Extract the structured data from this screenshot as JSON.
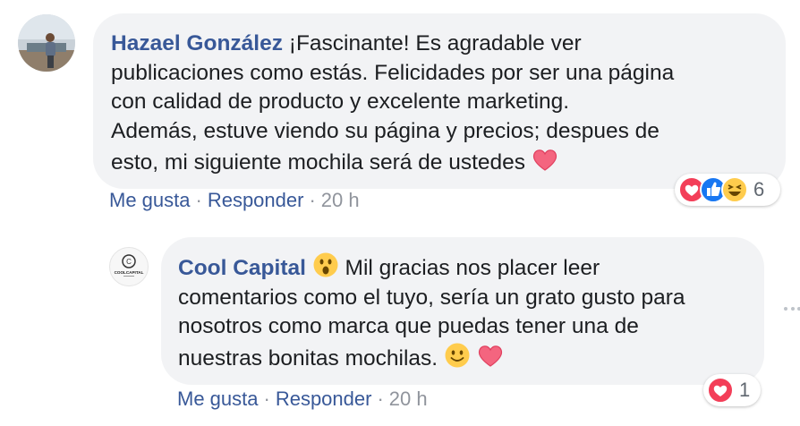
{
  "comment": {
    "author": "Hazael González",
    "text_lines": [
      "¡Fascinante! Es agradable ver",
      "publicaciones como estás. Felicidades por ser una página",
      "con calidad de producto y excelente marketing.",
      "Además, estuve viendo su página y precios; despues de",
      "esto, mi siguiente mochila será de ustedes"
    ],
    "actions": {
      "like": "Me gusta",
      "reply": "Responder",
      "separator": "·",
      "time": "20 h"
    },
    "reactions": {
      "icons": [
        "heart-icon",
        "like-icon",
        "laugh-icon"
      ],
      "count": "6"
    }
  },
  "reply": {
    "author": "Cool Capital",
    "avatar_logo_text": "COOLCAPITAL",
    "text_lines": [
      "Mil gracias nos placer leer",
      "comentarios como el tuyo, sería un grato gusto para",
      "nosotros como marca que puedas tener una de",
      "nuestras bonitas mochilas."
    ],
    "actions": {
      "like": "Me gusta",
      "reply": "Responder",
      "separator": "·",
      "time": "20 h"
    },
    "reactions": {
      "icons": [
        "heart-icon"
      ],
      "count": "1"
    }
  },
  "colors": {
    "link": "#385898",
    "bubble": "#f2f3f5",
    "heart": "#f33e58",
    "like": "#1877f2",
    "emoji": "#ffcc4d"
  }
}
